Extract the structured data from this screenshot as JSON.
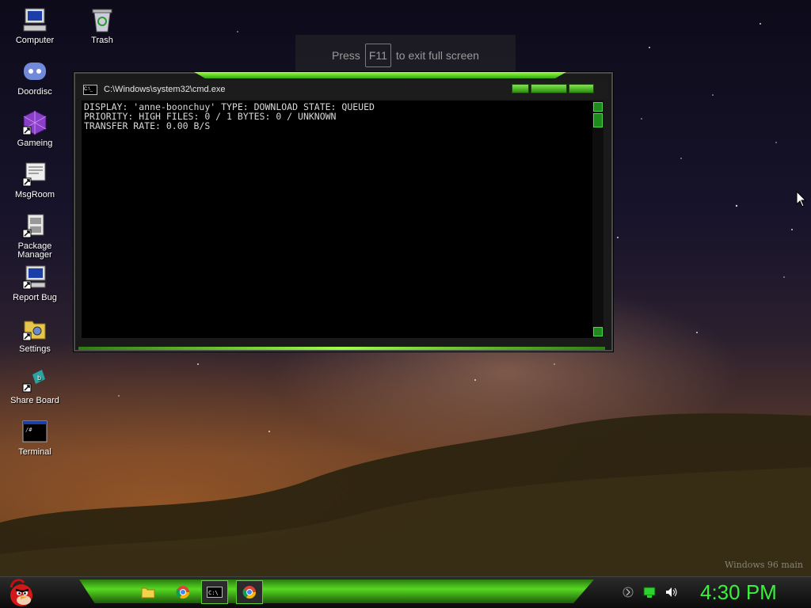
{
  "desktop": {
    "icons": [
      {
        "label": "Computer",
        "icon": "computer-icon"
      },
      {
        "label": "Trash",
        "icon": "trash-icon"
      },
      {
        "label": "Doordisc",
        "icon": "doordisc-icon"
      },
      {
        "label": "Gameing",
        "icon": "gameing-icon"
      },
      {
        "label": "MsgRoom",
        "icon": "msgroom-icon"
      },
      {
        "label": "Package Manager",
        "icon": "package-manager-icon"
      },
      {
        "label": "Report Bug",
        "icon": "report-bug-icon"
      },
      {
        "label": "Settings",
        "icon": "settings-icon"
      },
      {
        "label": "Share Board",
        "icon": "share-board-icon"
      },
      {
        "label": "Terminal",
        "icon": "terminal-icon"
      }
    ]
  },
  "fullscreen_hint": {
    "press": "Press",
    "key": "F11",
    "suffix": "to exit full screen"
  },
  "cmd_window": {
    "title": "C:\\Windows\\system32\\cmd.exe",
    "lines": [
      "DISPLAY: 'anne-boonchuy' TYPE: DOWNLOAD STATE: QUEUED",
      "PRIORITY: HIGH FILES: 0 / 1 BYTES: 0 / UNKNOWN",
      "TRANSFER RATE: 0.00 B/S"
    ]
  },
  "taskbar": {
    "items": [
      {
        "icon": "file-explorer-icon"
      },
      {
        "icon": "chrome-icon"
      },
      {
        "icon": "cmd-icon",
        "active": true
      },
      {
        "icon": "chrome-icon",
        "active": true
      }
    ],
    "tray": [
      "keyboard-icon",
      "network-icon",
      "volume-icon"
    ],
    "clock": "4:30 PM"
  },
  "watermark": "Windows 96 main",
  "colors": {
    "accent_green": "#57d922",
    "clock_green": "#3af03a"
  }
}
